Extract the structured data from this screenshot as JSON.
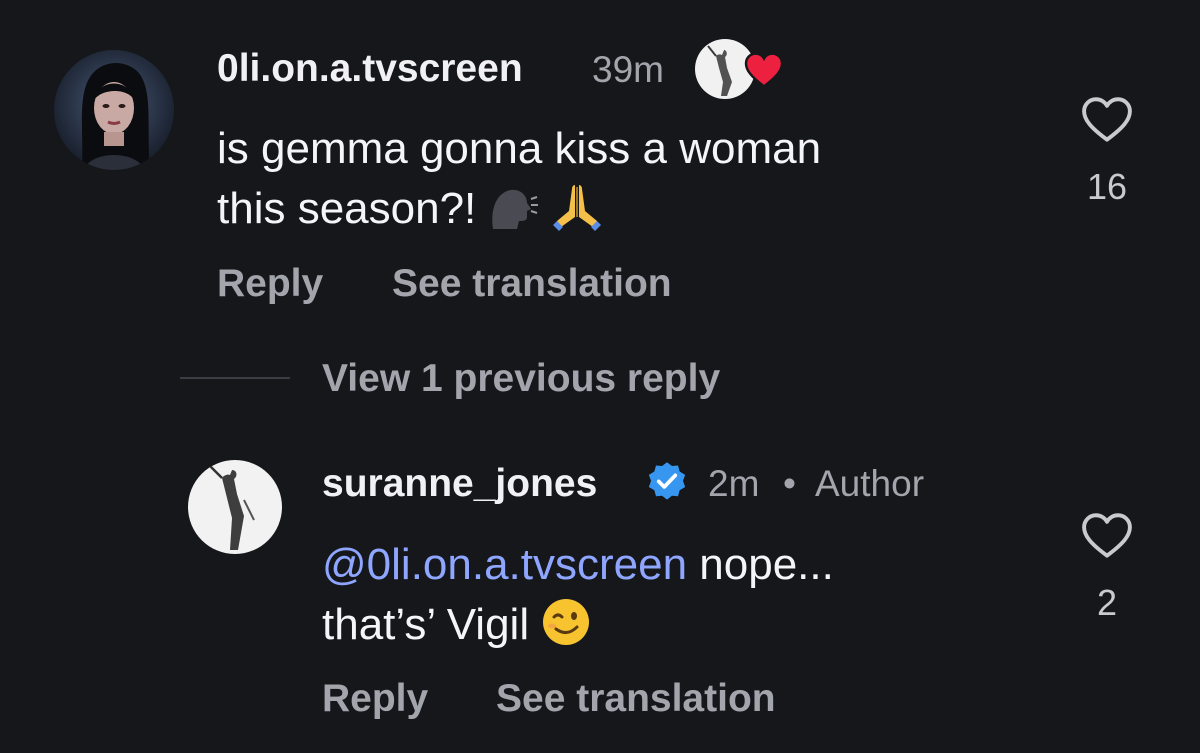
{
  "comment": {
    "username": "0li.on.a.tvscreen",
    "time": "39m",
    "text_line1": "is gemma gonna kiss a woman",
    "text_line2": "this season?!",
    "emoji_icons": [
      "speaking-head-icon",
      "folded-hands-icon"
    ],
    "reply_label": "Reply",
    "translate_label": "See translation",
    "like_count": "16"
  },
  "thread": {
    "view_replies_label": "View 1 previous reply"
  },
  "reply": {
    "username": "suranne_jones",
    "time": "2m",
    "separator": "•",
    "author_badge": "Author",
    "mention": "@0li.on.a.tvscreen",
    "text_line1_rest": " nope...",
    "text_line2": "that’s’ Vigil",
    "emoji_icon": "winking-face-icon",
    "reply_label": "Reply",
    "translate_label": "See translation",
    "like_count": "2"
  },
  "colors": {
    "background": "#16171b",
    "mention": "#8ea6ff",
    "verified": "#3797f0",
    "secondary_text": "#a3a5ad",
    "heart_liked": "#ed2040"
  }
}
